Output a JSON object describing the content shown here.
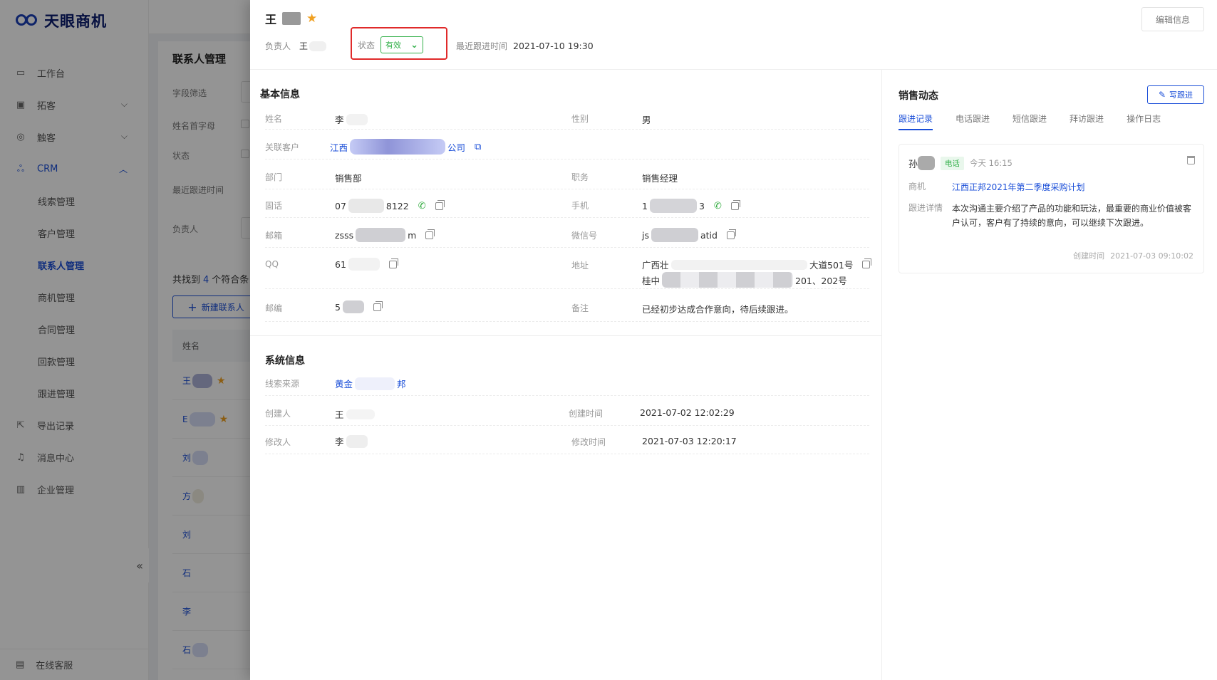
{
  "app": {
    "logo_text": "天眼商机"
  },
  "sidebar": {
    "items": [
      {
        "label": "工作台",
        "icon": "monitor-icon"
      },
      {
        "label": "拓客",
        "icon": "briefcase-icon",
        "has_chevron": true
      },
      {
        "label": "触客",
        "icon": "target-icon",
        "has_chevron": true
      },
      {
        "label": "CRM",
        "icon": "users-icon",
        "has_chevron": true,
        "expanded": true
      }
    ],
    "crm_children": [
      "线索管理",
      "客户管理",
      "联系人管理",
      "商机管理",
      "合同管理",
      "回款管理",
      "跟进管理"
    ],
    "current": "联系人管理",
    "bottom_items": [
      {
        "label": "导出记录",
        "icon": "export-icon"
      },
      {
        "label": "消息中心",
        "icon": "bell-icon"
      },
      {
        "label": "企业管理",
        "icon": "chart-icon"
      }
    ],
    "collapse_glyph": "«",
    "support": {
      "label": "在线客服",
      "icon": "chat-icon"
    }
  },
  "background_list": {
    "title": "联系人管理",
    "filters": [
      "字段筛选",
      "姓名首字母",
      "状态",
      "最近跟进时间",
      "负责人"
    ],
    "count_prefix": "共找到",
    "count": "4",
    "count_suffix": "个符合条",
    "new_button": "新建联系人",
    "column_name": "姓名",
    "rows": [
      "王",
      "E",
      "刘",
      "方",
      "刘",
      "石",
      "李",
      "石"
    ]
  },
  "drawer": {
    "header": {
      "name": "王",
      "owner_label": "负责人",
      "owner_value": "王",
      "status_label": "状态",
      "status_value": "有效",
      "last_follow_label": "最近跟进时间",
      "last_follow_value": "2021-07-10 19:30",
      "edit_button": "编辑信息"
    },
    "basic": {
      "title": "基本信息",
      "name_label": "姓名",
      "name_value": "李",
      "gender_label": "性别",
      "gender_value": "男",
      "customer_label": "关联客户",
      "customer_prefix": "江西",
      "customer_suffix": "公司",
      "dept_label": "部门",
      "dept_value": "销售部",
      "title_label": "职务",
      "title_value": "销售经理",
      "tel_label": "固话",
      "tel_prefix": "07",
      "tel_suffix": "8122",
      "mobile_label": "手机",
      "mobile_prefix": "1",
      "mobile_suffix": "3",
      "email_label": "邮箱",
      "email_prefix": "zsss",
      "email_suffix": "m",
      "wechat_label": "微信号",
      "wechat_prefix": "js",
      "wechat_suffix": "atid",
      "qq_label": "QQ",
      "qq_value": "61",
      "address_label": "地址",
      "address_line1_prefix": "广西壮",
      "address_line1_suffix": "大道501号",
      "address_line2_prefix": "桂中",
      "address_line2_suffix": "201、202号",
      "zip_label": "邮编",
      "zip_value": "5",
      "remark_label": "备注",
      "remark_value": "已经初步达成合作意向，待后续跟进。"
    },
    "system": {
      "title": "系统信息",
      "source_label": "线索来源",
      "source_prefix": "黄金",
      "source_suffix": "邦",
      "creator_label": "创建人",
      "creator_value": "王",
      "created_label": "创建时间",
      "created_value": "2021-07-02 12:02:29",
      "modifier_label": "修改人",
      "modifier_value": "李",
      "modified_label": "修改时间",
      "modified_value": "2021-07-03 12:20:17"
    },
    "sales": {
      "title": "销售动态",
      "write_button": "写跟进",
      "tabs": [
        "跟进记录",
        "电话跟进",
        "短信跟进",
        "拜访跟进",
        "操作日志"
      ],
      "active_tab": 0,
      "record": {
        "person": "孙",
        "tag": "电话",
        "time": "今天 16:15",
        "opportunity_label": "商机",
        "opportunity_value": "江西正邦2021年第二季度采购计划",
        "detail_label": "跟进详情",
        "detail_value": "本次沟通主要介绍了产品的功能和玩法，最重要的商业价值被客户认可，客户有了持续的意向，可以继续下次跟进。",
        "created_label": "创建时间",
        "created_value": "2021-07-03 09:10:02"
      }
    }
  },
  "colors": {
    "primary": "#1a4ed8",
    "success": "#33b04a",
    "highlight_border": "#e02a2a",
    "star": "#f0a020"
  }
}
